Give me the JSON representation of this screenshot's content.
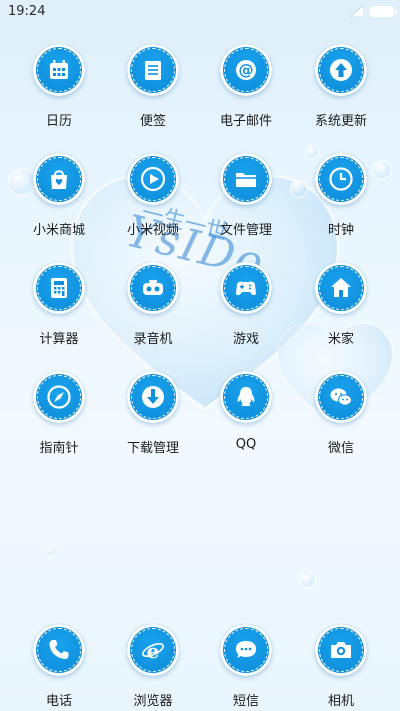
{
  "status_bar": {
    "time": "19:24"
  },
  "apps": [
    {
      "label": "日历",
      "icon": "calendar-icon"
    },
    {
      "label": "便签",
      "icon": "notes-icon"
    },
    {
      "label": "电子邮件",
      "icon": "email-icon"
    },
    {
      "label": "系统更新",
      "icon": "update-arrow-icon"
    },
    {
      "label": "小米商城",
      "icon": "shopping-bag-icon"
    },
    {
      "label": "小米视频",
      "icon": "play-icon"
    },
    {
      "label": "文件管理",
      "icon": "folder-icon"
    },
    {
      "label": "时钟",
      "icon": "clock-icon"
    },
    {
      "label": "计算器",
      "icon": "calculator-icon"
    },
    {
      "label": "录音机",
      "icon": "recorder-icon"
    },
    {
      "label": "游戏",
      "icon": "gamepad-icon"
    },
    {
      "label": "米家",
      "icon": "home-icon"
    },
    {
      "label": "指南针",
      "icon": "compass-icon"
    },
    {
      "label": "下载管理",
      "icon": "download-icon"
    },
    {
      "label": "QQ",
      "icon": "qq-penguin-icon"
    },
    {
      "label": "微信",
      "icon": "wechat-icon"
    }
  ],
  "dock": [
    {
      "label": "电话",
      "icon": "phone-icon"
    },
    {
      "label": "浏览器",
      "icon": "browser-icon"
    },
    {
      "label": "短信",
      "icon": "message-icon"
    },
    {
      "label": "相机",
      "icon": "camera-icon"
    }
  ],
  "wallpaper_text": {
    "title": "YsIDo",
    "subtitle": "一生一世"
  },
  "colors": {
    "icon_blue": "#0e8fdc",
    "label": "#1c1c1c"
  }
}
